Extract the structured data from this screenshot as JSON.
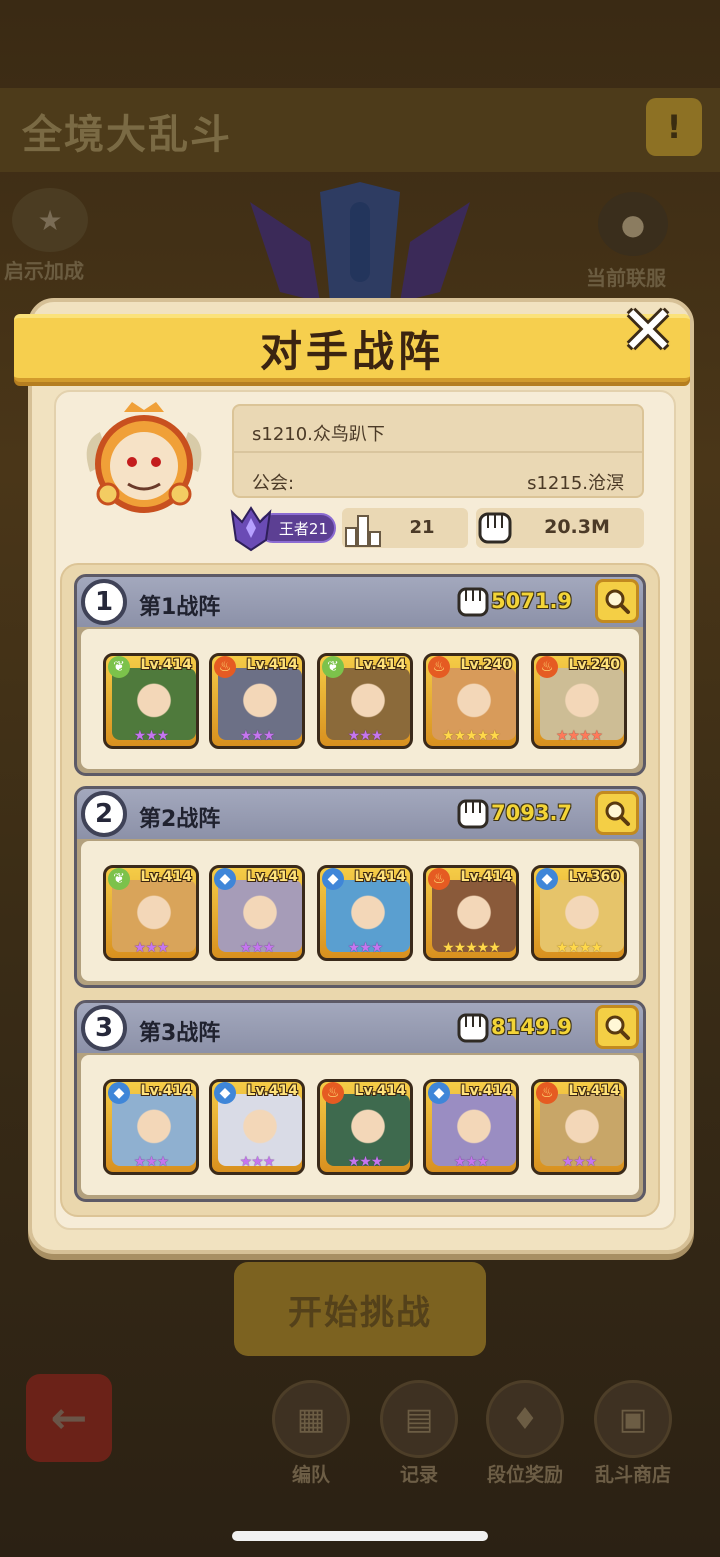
{
  "background": {
    "mode_title": "全境大乱斗",
    "info_button": "!",
    "left_button_label": "启示加成",
    "right_button_label": "当前联服",
    "start_button": "开始挑战",
    "back_button": "←",
    "nav": [
      {
        "label": "编队",
        "icon": "formation-icon"
      },
      {
        "label": "记录",
        "icon": "record-icon"
      },
      {
        "label": "段位奖励",
        "icon": "rank-reward-icon"
      },
      {
        "label": "乱斗商店",
        "icon": "shop-icon"
      }
    ]
  },
  "modal": {
    "title": "对手战阵",
    "close": "✕",
    "player": {
      "name": "s1210.众鸟趴下",
      "guild_label": "公会:",
      "guild_value": "s1215.沧溟",
      "rank": "王者21",
      "ladder_value": "21",
      "power": "20.3M"
    },
    "lineups": [
      {
        "number": "1",
        "title": "第1战阵",
        "power": "5071.9",
        "heroes": [
          {
            "level": "Lv.414",
            "element": "leaf",
            "stars": "★★★",
            "star_color": "purple",
            "face": "#4f7a3c"
          },
          {
            "level": "Lv.414",
            "element": "fire",
            "stars": "★★★",
            "star_color": "purple",
            "face": "#6c7086"
          },
          {
            "level": "Lv.414",
            "element": "leaf",
            "stars": "★★★",
            "star_color": "purple",
            "face": "#8b6a3a"
          },
          {
            "level": "Lv.240",
            "element": "fire",
            "stars": "★★★★★",
            "star_color": "gold",
            "face": "#d89b5a"
          },
          {
            "level": "Lv.240",
            "element": "fire",
            "stars": "★★★★",
            "star_color": "red",
            "face": "#cdbd95"
          }
        ]
      },
      {
        "number": "2",
        "title": "第2战阵",
        "power": "7093.7",
        "heroes": [
          {
            "level": "Lv.414",
            "element": "leaf",
            "stars": "★★★",
            "star_color": "purple",
            "face": "#d9a45a"
          },
          {
            "level": "Lv.414",
            "element": "water",
            "stars": "★★★",
            "star_color": "purple",
            "face": "#a69cb8"
          },
          {
            "level": "Lv.414",
            "element": "water",
            "stars": "★★★",
            "star_color": "purple",
            "face": "#5a9fd0"
          },
          {
            "level": "Lv.414",
            "element": "fire",
            "stars": "★★★★★",
            "star_color": "gold",
            "face": "#8a5a3a"
          },
          {
            "level": "Lv.360",
            "element": "water",
            "stars": "★★★★",
            "star_color": "gold",
            "face": "#e6c46a"
          }
        ]
      },
      {
        "number": "3",
        "title": "第3战阵",
        "power": "8149.9",
        "heroes": [
          {
            "level": "Lv.414",
            "element": "water",
            "stars": "★★★",
            "star_color": "purple",
            "face": "#8fb0d0"
          },
          {
            "level": "Lv.414",
            "element": "water",
            "stars": "★★★",
            "star_color": "purple",
            "face": "#d9dbe6"
          },
          {
            "level": "Lv.414",
            "element": "fire",
            "stars": "★★★",
            "star_color": "purple",
            "face": "#3e6a4e"
          },
          {
            "level": "Lv.414",
            "element": "water",
            "stars": "★★★",
            "star_color": "purple",
            "face": "#9a8dc2"
          },
          {
            "level": "Lv.414",
            "element": "fire",
            "stars": "★★★",
            "star_color": "purple",
            "face": "#c8a668"
          }
        ]
      }
    ]
  }
}
